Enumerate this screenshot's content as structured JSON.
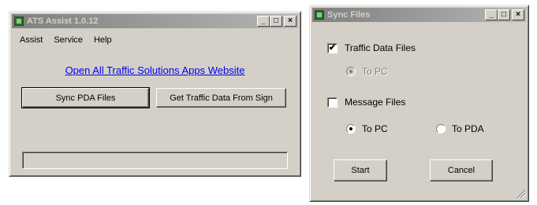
{
  "ats_window": {
    "title": "ATS Assist 1.0.12",
    "menu": [
      "Assist",
      "Service",
      "Help"
    ],
    "link_text": "Open All Traffic Solutions Apps Website",
    "sync_button": "Sync PDA Files",
    "get_data_button": "Get Traffic Data From Sign",
    "controls": {
      "minimize": "_",
      "maximize": "□",
      "close": "×"
    }
  },
  "sync_window": {
    "title": "Sync Files",
    "traffic_files": {
      "label": "Traffic Data Files",
      "checked": true,
      "check_glyph": "✔"
    },
    "traffic_to_pc": {
      "label": "To PC",
      "selected": true,
      "disabled": true
    },
    "message_files": {
      "label": "Message Files",
      "checked": false
    },
    "message_to_pc": {
      "label": "To PC",
      "selected": true
    },
    "message_to_pda": {
      "label": "To PDA",
      "selected": false
    },
    "start_button": "Start",
    "cancel_button": "Cancel",
    "controls": {
      "minimize": "_",
      "maximize": "□",
      "close": "×"
    }
  }
}
